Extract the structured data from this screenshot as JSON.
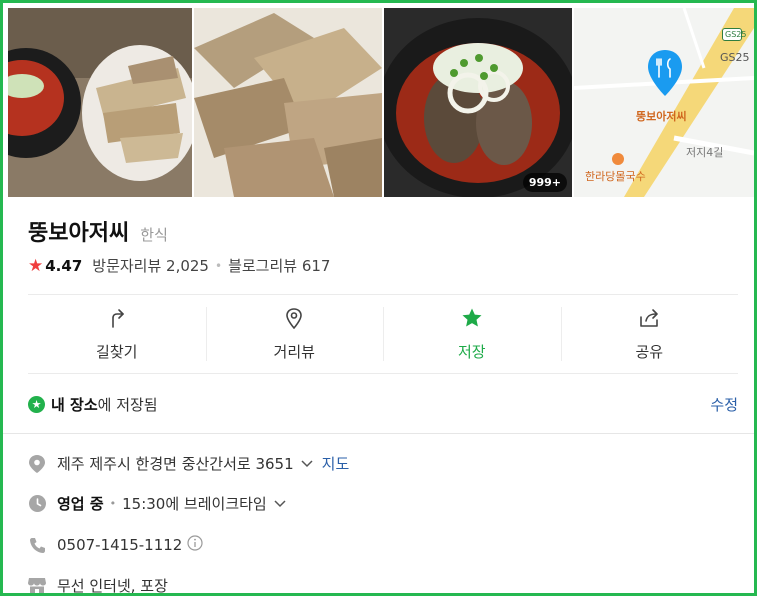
{
  "place": {
    "name": "뚱보아저씨",
    "category": "한식",
    "rating": "4.47",
    "visitor_reviews": "방문자리뷰 2,025",
    "blog_reviews": "블로그리뷰 617",
    "photo_count": "999+"
  },
  "map": {
    "pin_label": "뚱보아저씨",
    "nearby_label": "한라당몰국수",
    "road_label": "저지4길",
    "station_label": "GS25",
    "station_sign": "GS25"
  },
  "actions": [
    {
      "label": "길찾기",
      "icon": "directions-icon"
    },
    {
      "label": "거리뷰",
      "icon": "street-view-icon"
    },
    {
      "label": "저장",
      "icon": "star-icon"
    },
    {
      "label": "공유",
      "icon": "share-icon"
    }
  ],
  "saved": {
    "strong": "내 장소",
    "rest": "에 저장됨",
    "edit": "수정"
  },
  "info": {
    "address": "제주 제주시 한경면 중산간서로 3651",
    "map_link": "지도",
    "status": "영업 중",
    "hours": "15:30에 브레이크타임",
    "phone": "0507-1415-1112",
    "amenities": "무선 인터넷, 포장"
  },
  "colors": {
    "frame_border": "#25b850",
    "saved_green": "#1eaa48",
    "link_blue": "#2a5fa8",
    "rating_star": "#f03e3e"
  }
}
